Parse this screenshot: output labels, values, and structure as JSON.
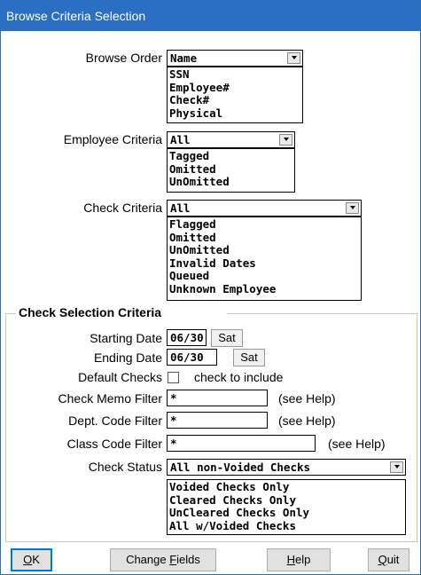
{
  "window": {
    "title": "Browse Criteria Selection"
  },
  "browse_order": {
    "label": "Browse Order",
    "selected": "Name",
    "options": [
      "SSN",
      "Employee#",
      "Check#",
      "Physical"
    ]
  },
  "employee_criteria": {
    "label": "Employee Criteria",
    "selected": "All",
    "options": [
      "Tagged",
      "Omitted",
      "UnOmitted"
    ]
  },
  "check_criteria": {
    "label": "Check Criteria",
    "selected": "All",
    "options": [
      "Flagged",
      "Omitted",
      "UnOmitted",
      "Invalid Dates",
      "Queued",
      "Unknown Employee"
    ]
  },
  "check_selection": {
    "group_title": "Check Selection Criteria",
    "starting_date": {
      "label": "Starting Date",
      "value": "06/30",
      "button": "Sat"
    },
    "ending_date": {
      "label": "Ending Date",
      "value": "06/30",
      "button": "Sat"
    },
    "default_checks": {
      "label": "Default Checks",
      "checkbox_text": "check to include",
      "checked": false
    },
    "memo_filter": {
      "label": "Check Memo Filter",
      "value": "*",
      "help": "(see Help)"
    },
    "dept_filter": {
      "label": "Dept. Code Filter",
      "value": "*",
      "help": "(see Help)"
    },
    "class_filter": {
      "label": "Class Code Filter",
      "value": "*",
      "help": "(see Help)"
    },
    "check_status": {
      "label": "Check Status",
      "selected": "All non-Voided Checks",
      "options": [
        "Voided Checks Only",
        "Cleared Checks Only",
        "UnCleared Checks Only",
        "All w/Voided Checks"
      ]
    }
  },
  "buttons": {
    "ok": {
      "accel": "O",
      "rest": "K"
    },
    "change_fields": {
      "pre": "Change ",
      "accel": "F",
      "rest": "ields"
    },
    "help": {
      "accel": "H",
      "rest": "elp"
    },
    "quit": {
      "accel": "Q",
      "rest": "uit"
    }
  }
}
